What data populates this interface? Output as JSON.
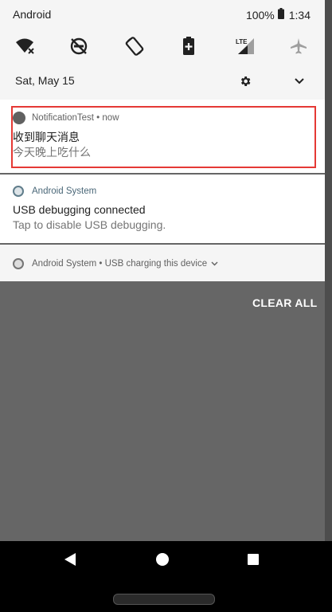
{
  "status_bar": {
    "carrier": "Android",
    "battery": "100%",
    "time": "1:34"
  },
  "quick_settings": {
    "tiles": [
      {
        "name": "wifi-off-icon"
      },
      {
        "name": "dnd-icon"
      },
      {
        "name": "auto-rotate-icon"
      },
      {
        "name": "battery-saver-icon"
      },
      {
        "name": "lte-signal-icon"
      },
      {
        "name": "airplane-mode-icon"
      }
    ],
    "date": "Sat, May 15"
  },
  "notifications": [
    {
      "app": "NotificationTest",
      "time": "now",
      "title": "收到聊天消息",
      "text": "今天晚上吃什么"
    },
    {
      "app": "Android System",
      "title": "USB debugging connected",
      "text": "Tap to disable USB debugging."
    },
    {
      "app": "Android System",
      "summary": "USB charging this device"
    }
  ],
  "clear_all_label": "CLEAR ALL",
  "colors": {
    "highlight_border": "#e53935",
    "scrim": "#666666",
    "nav_bar": "#000000"
  }
}
